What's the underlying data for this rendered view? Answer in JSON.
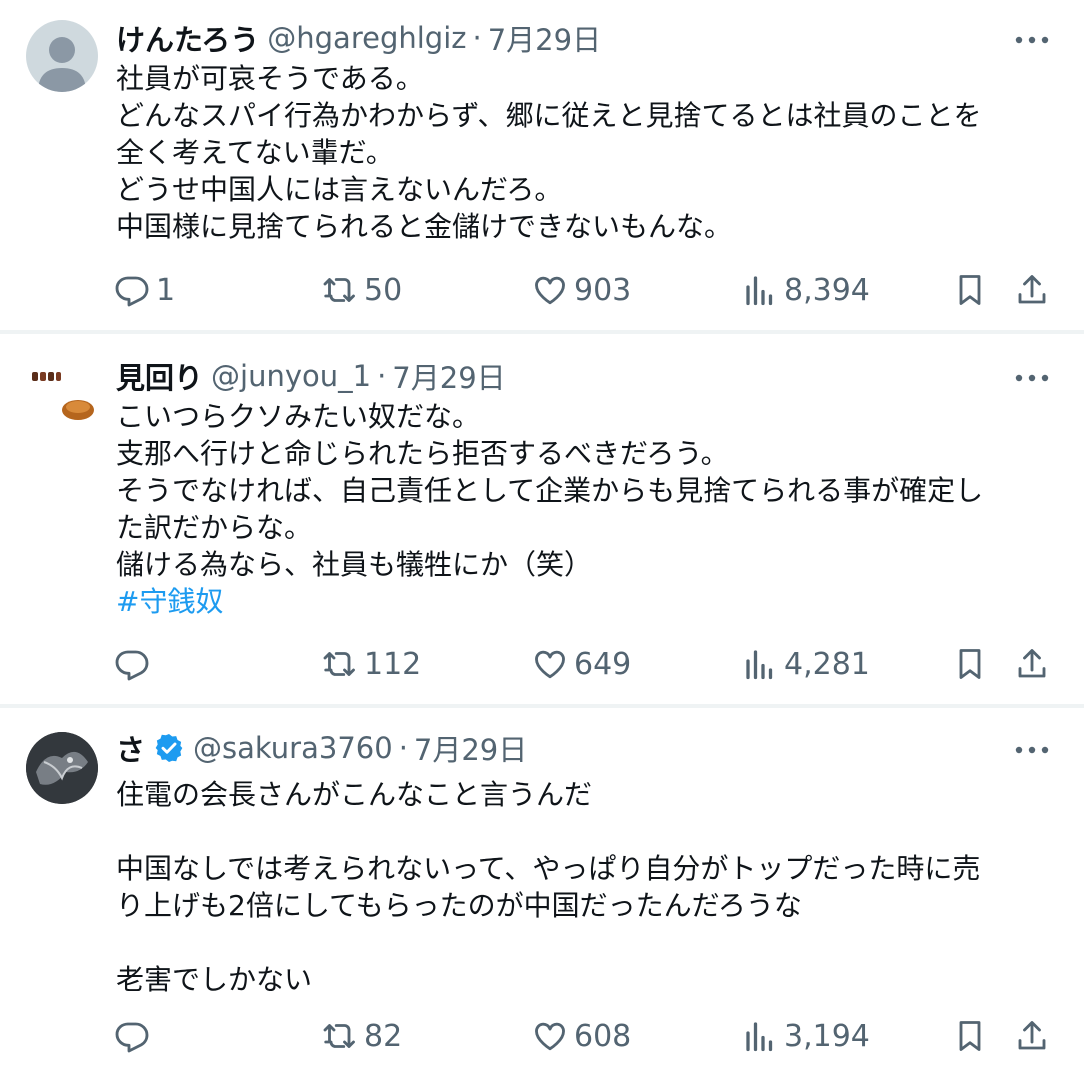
{
  "tweets": [
    {
      "name": "けんたろう",
      "handle": "@hgareghlgiz",
      "separator": "·",
      "date": "7月29日",
      "verified": false,
      "lines": [
        "社員が可哀そうである。",
        "どんなスパイ行為かわからず、郷に従えと見捨てるとは社員のことを",
        "全く考えてない輩だ。",
        "どうせ中国人には言えないんだろ。",
        "中国様に見捨てられると金儲けできないもんな。"
      ],
      "hashtag": "",
      "replies": "1",
      "retweets": "50",
      "likes": "903",
      "views": "8,394"
    },
    {
      "name": "見回り",
      "handle": "@junyou_1",
      "separator": "·",
      "date": "7月29日",
      "verified": false,
      "lines": [
        "こいつらクソみたい奴だな。",
        "支那へ行けと命じられたら拒否するべきだろう。",
        "そうでなければ、自己責任として企業からも見捨てられる事が確定し",
        "た訳だからな。",
        "儲ける為なら、社員も犠牲にか（笑）"
      ],
      "hashtag": "#守銭奴",
      "replies": "",
      "retweets": "112",
      "likes": "649",
      "views": "4,281"
    },
    {
      "name": "さ",
      "handle": "@sakura3760",
      "separator": "·",
      "date": "7月29日",
      "verified": true,
      "lines": [
        "住電の会長さんがこんなこと言うんだ",
        "",
        "中国なしでは考えられないって、やっぱり自分がトップだった時に売",
        "り上げも2倍にしてもらったのが中国だったんだろうな",
        "",
        "老害でしかない"
      ],
      "hashtag": "",
      "replies": "",
      "retweets": "82",
      "likes": "608",
      "views": "3,194"
    }
  ],
  "colors": {
    "text": "#0f1419",
    "secondary": "#536471",
    "link": "#1d9bf0",
    "separator": "#eff3f4",
    "verified_badge": "#1d9bf0"
  },
  "icons": {
    "reply": "reply-icon",
    "retweet": "retweet-icon",
    "like": "like-icon",
    "views": "views-icon",
    "bookmark": "bookmark-icon",
    "share": "share-icon",
    "more": "more-icon"
  }
}
